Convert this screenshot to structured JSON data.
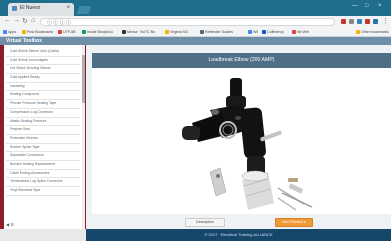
{
  "browser": {
    "tab_title": "El Nuevo",
    "url": "ⓘ ⓘ ⓘ ⓘ",
    "bookmarks": [
      "Apps",
      "Post Bookmarks",
      "UTF-8B",
      "Inside Bostpil.cu",
      "Meraa · NoTC Bo",
      "Virginia NO",
      "Reflender Guides",
      "Wii",
      "Cuffinency",
      "Ne Wet",
      "Other bookmarks"
    ]
  },
  "app": {
    "title": "Virtual Toolbox"
  },
  "sidebar": {
    "items": [
      "Cold Shrink Sleeve Joint (Cable)",
      "Cold Shrink Joint Adapter",
      "Hot Shrink Bonding Sleeve",
      "Cold Applied Ready",
      "Insulating",
      "Sealing Compound",
      "Precise Pressure Sealing Tape",
      "Compression Lug Connector",
      "Mastic Sealing Pressure",
      "Prepare Seal",
      "Protective Sleeves",
      "Rubber Splice Tape",
      "Separable Connectors",
      "Bonded Sealing Replacement",
      "Cable Ending Accessories",
      "Terminations Lug Splice Connector",
      "Vinyl Electrical Tape"
    ],
    "footer": "◀ ☰"
  },
  "main": {
    "title": "Loadbreak Elbow (200 AMP)",
    "description_button": "Description",
    "next_button": "Next Product ▸"
  },
  "footer": {
    "text": "© 2017 · Electrical Training ALLIANCE"
  }
}
